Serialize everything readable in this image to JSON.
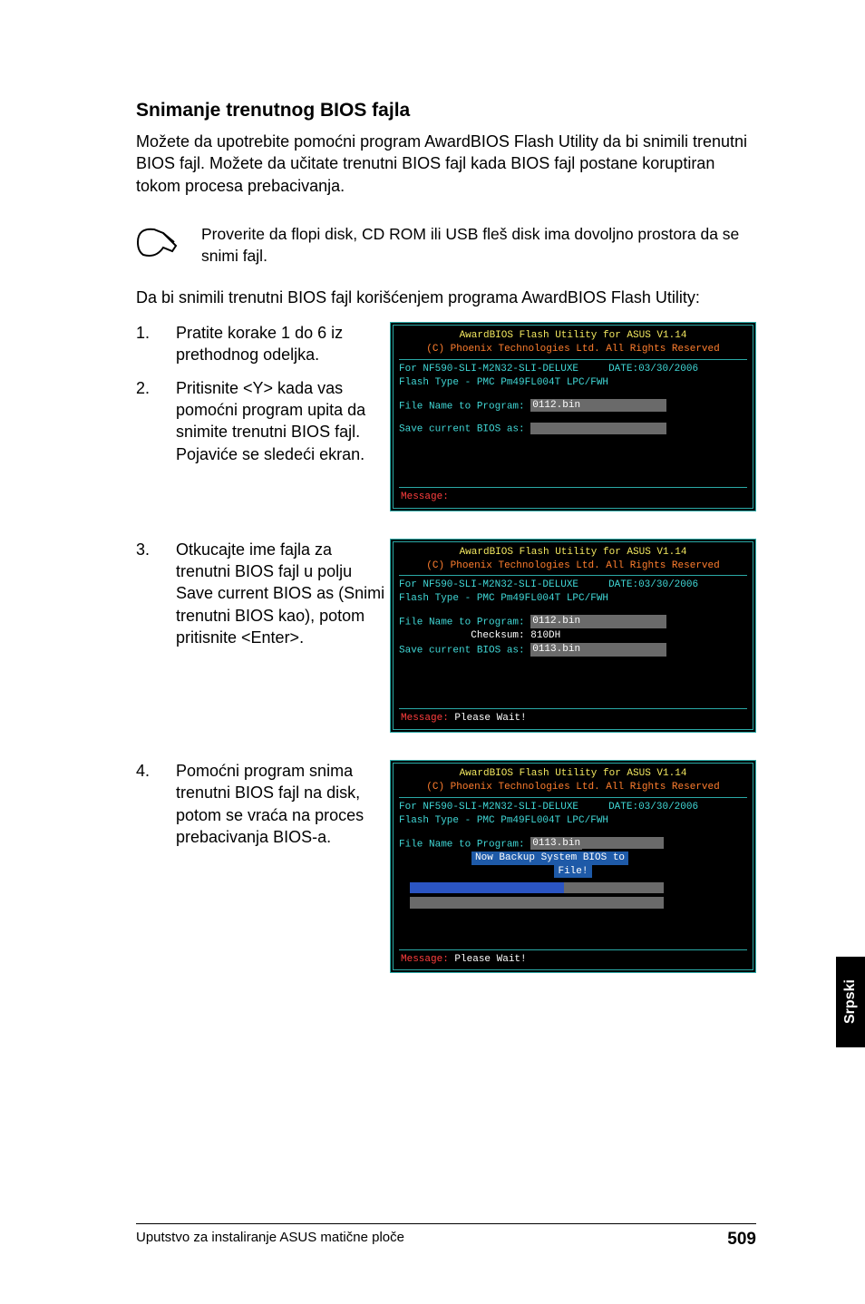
{
  "heading": "Snimanje trenutnog BIOS fajla",
  "intro": "Možete da upotrebite pomoćni program AwardBIOS Flash Utility da bi snimili trenutni BIOS fajl. Možete da učitate trenutni BIOS fajl kada BIOS fajl postane koruptiran tokom procesa prebacivanja.",
  "note": "Proverite da flopi disk, CD ROM ili USB fleš disk ima dovoljno prostora da se snimi fajl.",
  "lead": "Da bi snimili trenutni BIOS fajl korišćenjem programa AwardBIOS Flash Utility:",
  "steps": {
    "s1": {
      "num": "1.",
      "text": "Pratite korake 1 do 6 iz prethodnog odeljka."
    },
    "s2": {
      "num": "2.",
      "text": "Pritisnite <Y> kada vas pomoćni program upita da snimite trenutni BIOS fajl. Pojaviće se sledeći ekran."
    },
    "s3": {
      "num": "3.",
      "text": "Otkucajte ime fajla za trenutni BIOS fajl u polju Save current BIOS as (Snimi trenutni BIOS kao), potom pritisnite <Enter>."
    },
    "s4": {
      "num": "4.",
      "text": "Pomoćni program snima trenutni BIOS fajl na disk, potom se vraća na proces prebacivanja BIOS-a."
    }
  },
  "term_common": {
    "title": "AwardBIOS Flash Utility for ASUS V1.14",
    "copyright": "(C) Phoenix Technologies Ltd. All Rights Reserved",
    "board": "For NF590-SLI-M2N32-SLI-DELUXE",
    "date": "DATE:03/30/2006",
    "flash_type": "Flash Type - PMC Pm49FL004T LPC/FWH",
    "file_name_label": "File Name to Program:",
    "save_label": "Save current BIOS as:",
    "checksum_label": "Checksum:",
    "message_label": "Message:",
    "please_wait": "Please Wait!"
  },
  "term1": {
    "file_name_val": "0112.bin",
    "save_val": ""
  },
  "term2": {
    "file_name_val": "0112.bin",
    "checksum_val": "810DH",
    "save_val": "0113.bin"
  },
  "term3": {
    "file_name_val": "0113.bin",
    "backup_line1": "Now Backup System BIOS to",
    "backup_line2": "File!"
  },
  "sidebar": "Srpski",
  "footer_left": "Uputstvo za instaliranje ASUS matične ploče",
  "footer_page": "509"
}
